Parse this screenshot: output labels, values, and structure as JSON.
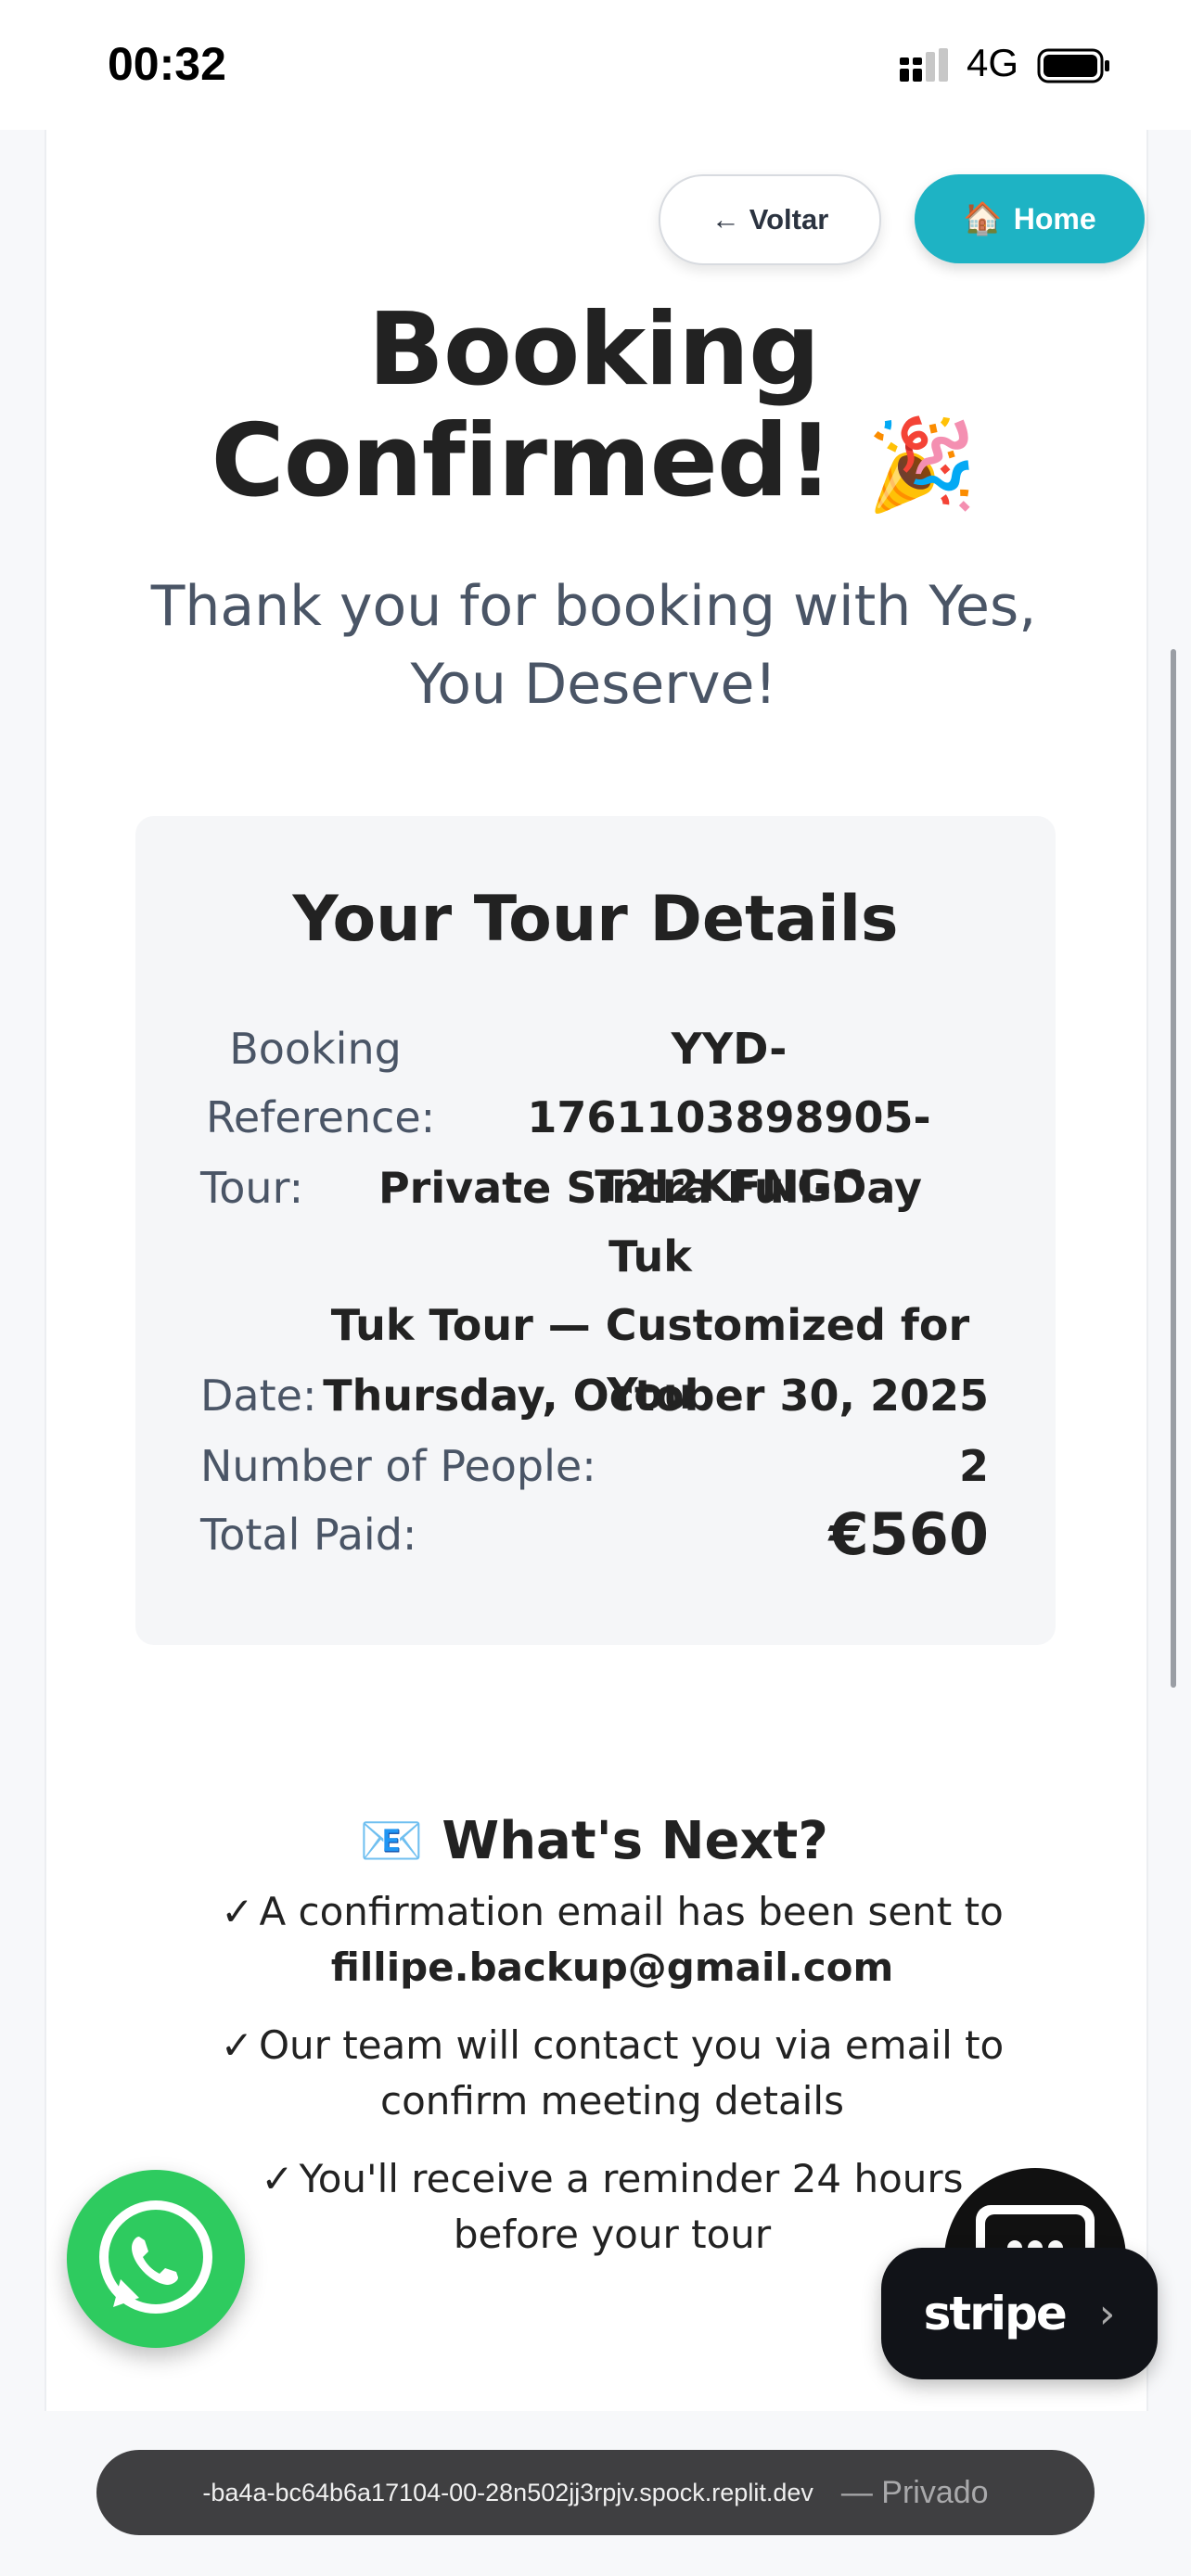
{
  "status_bar": {
    "time": "00:32",
    "network": "4G"
  },
  "nav": {
    "back_label": "Voltar",
    "back_arrow": "←",
    "home_label": "Home",
    "home_icon": "🏠"
  },
  "confirmation": {
    "title_line1": "Booking",
    "title_line2": "Confirmed!",
    "title_emoji": "🎉",
    "subtitle_line1": "Thank you for booking with Yes,",
    "subtitle_line2": "You Deserve!"
  },
  "details": {
    "heading": "Your Tour Details",
    "reference_label_line1": "Booking",
    "reference_label_line2": "Reference:",
    "reference_value_line1": "YYD-1761103898905-",
    "reference_value_line2": "T2I2KFNGC",
    "tour_label": "Tour:",
    "tour_value_line1": "Private Sintra Full-Day Tuk",
    "tour_value_line2": "Tuk Tour — Customized for",
    "tour_value_line3": "You",
    "date_label": "Date:",
    "date_value": "Thursday, October 30, 2025",
    "people_label": "Number of People:",
    "people_value": "2",
    "total_label": "Total Paid:",
    "total_value": "€560"
  },
  "next": {
    "icon": "📧",
    "heading": "What's Next?",
    "check": "✓",
    "item1_text": "A confirmation email has been sent to",
    "item1_email": "fillipe.backup@gmail.com",
    "item2_line1": "Our team will contact you via email to",
    "item2_line2": "confirm meeting details",
    "item3_line1": "You'll receive a reminder 24 hours",
    "item3_line2": "before your tour"
  },
  "widgets": {
    "stripe_label": "stripe",
    "stripe_chevron": "›"
  },
  "browser": {
    "url": "-ba4a-bc64b6a17104-00-28n502jj3rpjv.spock.replit.dev",
    "mode": "— Privado"
  }
}
